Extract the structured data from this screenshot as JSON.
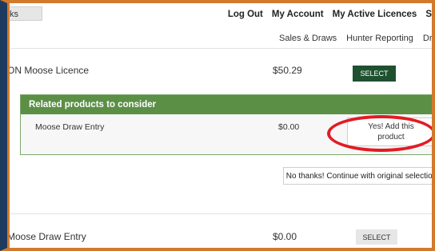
{
  "tab_fragment": "ks",
  "topnav": {
    "logout": "Log Out",
    "my_account": "My Account",
    "active_licences": "My Active Licences",
    "cut_item": "S"
  },
  "subnav": {
    "sales_draws": "Sales & Draws",
    "hunter_reporting": "Hunter Reporting",
    "draw_cut": "Draw"
  },
  "licence_row": {
    "name": "ON Moose Licence",
    "price": "$50.29",
    "button": "SELECT"
  },
  "related": {
    "heading": "Related products to consider",
    "item_name": "Moose Draw Entry",
    "item_price": "$0.00",
    "add_button": "Yes! Add this product",
    "decline_button": "No thanks! Continue with original selection"
  },
  "draw_row": {
    "name": "Moose Draw Entry",
    "price": "$0.00",
    "button": "SELECT"
  },
  "colors": {
    "frame_orange": "#d27a2c",
    "panel_green": "#5b8f46",
    "select_green": "#1f5030",
    "highlight_red": "#e21b23"
  }
}
